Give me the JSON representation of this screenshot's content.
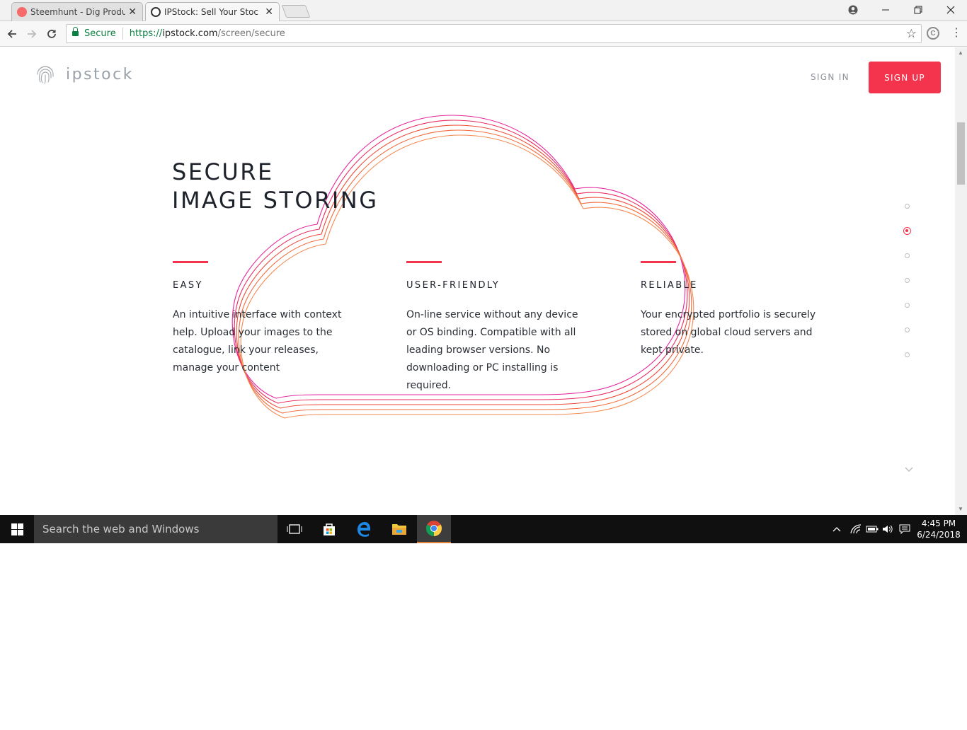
{
  "browser": {
    "tabs": [
      {
        "title": "Steemhunt - Dig Product",
        "favicon": "steemhunt-icon",
        "color": "#f56a6a"
      },
      {
        "title": "IPStock: Sell Your Stock Photos",
        "favicon": "ipstock-icon",
        "color": "#333333"
      }
    ],
    "secure_label": "Secure",
    "url_proto": "https://",
    "url_host": "ipstock.com",
    "url_path": "/screen/secure"
  },
  "site": {
    "logo_text": "ipstock",
    "sign_in": "SIGN IN",
    "sign_up": "SIGN UP",
    "accent": "#f4334d",
    "hero_line1": "SECURE",
    "hero_line2": "IMAGE STORING",
    "features": [
      {
        "title": "EASY",
        "desc": "An intuitive interface with context help. Upload your images to the catalogue, link your releases, manage your content"
      },
      {
        "title": "USER-FRIENDLY",
        "desc": "On-line service without any device or OS binding. Compatible with all leading browser versions. No downloading or PC installing is required."
      },
      {
        "title": "RELIABLE",
        "desc": "Your encrypted portfolio is securely stored on global cloud servers and kept private."
      }
    ],
    "pager": {
      "count": 7,
      "active_index": 1
    }
  },
  "taskbar": {
    "search_placeholder": "Search the web and Windows",
    "time": "4:45 PM",
    "date": "6/24/2018"
  }
}
